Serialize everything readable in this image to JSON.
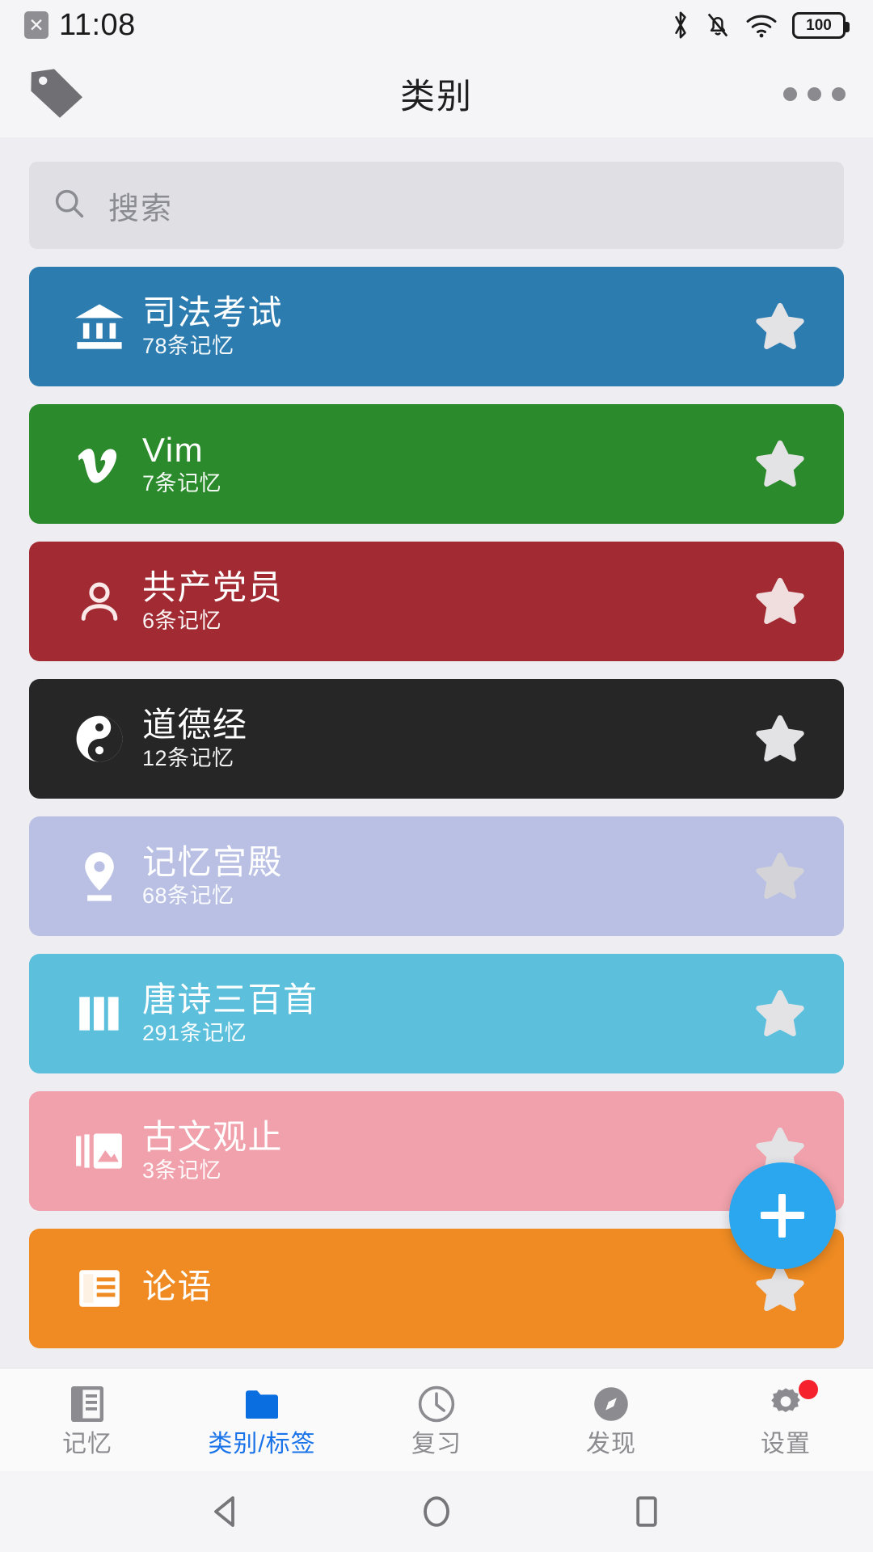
{
  "status_bar": {
    "time": "11:08",
    "sim_icon": "sim-error-icon",
    "battery_level": "100",
    "icons": [
      "bluetooth-icon",
      "mute-bell-icon",
      "wifi-icon",
      "battery-icon"
    ]
  },
  "header": {
    "left_icon": "tag-icon",
    "title": "类别",
    "more_icon": "more-options-icon"
  },
  "search": {
    "icon": "search-icon",
    "placeholder": "搜索",
    "value": ""
  },
  "categories": [
    {
      "title": "司法考试",
      "count_label": "78条记忆",
      "color": "#2c7cb0",
      "icon": "bank-icon",
      "starred": true,
      "star_color": "#e3e3e6"
    },
    {
      "title": "Vim",
      "count_label": "7条记忆",
      "color": "#2b8a2b",
      "icon": "vimeo-v-icon",
      "starred": true,
      "star_color": "#e3e3e6"
    },
    {
      "title": "共产党员",
      "count_label": "6条记忆",
      "color": "#a22b33",
      "icon": "person-icon",
      "starred": true,
      "star_color": "#f0dede"
    },
    {
      "title": "道德经",
      "count_label": "12条记忆",
      "color": "#262626",
      "icon": "yinyang-icon",
      "starred": true,
      "star_color": "#e3e3e6"
    },
    {
      "title": "记忆宫殿",
      "count_label": "68条记忆",
      "color": "#b9c0e3",
      "icon": "location-pin-icon",
      "starred": true,
      "star_color": "#d4d4d8"
    },
    {
      "title": "唐诗三百首",
      "count_label": "291条记忆",
      "color": "#5cc0dd",
      "icon": "books-columns-icon",
      "starred": true,
      "star_color": "#e3e3e6"
    },
    {
      "title": "古文观止",
      "count_label": "3条记忆",
      "color": "#f0a1ab",
      "icon": "collections-icon",
      "starred": true,
      "star_color": "#e3e3e6"
    },
    {
      "title": "论语",
      "count_label": "",
      "color": "#ef8b22",
      "icon": "article-book-icon",
      "starred": true,
      "star_color": "#e3e3e6"
    }
  ],
  "fab": {
    "icon": "plus-icon",
    "label": "+",
    "color": "#2aa7ef"
  },
  "bottom_nav": {
    "active_index": 1,
    "active_color": "#1a73e8",
    "items": [
      {
        "label": "记忆",
        "icon": "memo-icon",
        "badge": false
      },
      {
        "label": "类别/标签",
        "icon": "folder-icon",
        "badge": false
      },
      {
        "label": "复习",
        "icon": "clock-icon",
        "badge": false
      },
      {
        "label": "发现",
        "icon": "compass-icon",
        "badge": false
      },
      {
        "label": "设置",
        "icon": "gear-icon",
        "badge": true
      }
    ]
  },
  "system_nav": {
    "back": "back-triangle-icon",
    "home": "home-circle-icon",
    "recents": "recents-square-icon"
  }
}
